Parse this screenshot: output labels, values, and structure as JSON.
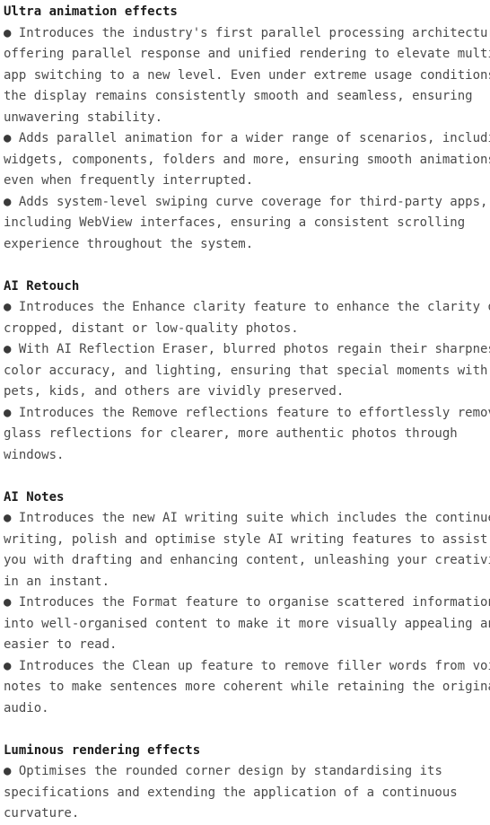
{
  "document": {
    "type": "release-notes",
    "background_color": "#ffffff",
    "heading_color": "#1b1b1b",
    "body_color": "#4a4a4a",
    "bullet_glyph": "●",
    "sections": [
      {
        "heading": "Ultra animation effects",
        "bullets": [
          {
            "lines": [
              "Introduces the industry's first parallel processing architecture,",
              "offering parallel response and unified rendering to elevate multi-",
              "app switching to a new level. Even under extreme usage conditions,",
              "the display remains consistently smooth and seamless, ensuring",
              "unwavering stability."
            ],
            "text": "Introduces the industry's first parallel processing architecture, offering parallel response and unified rendering to elevate multi-app switching to a new level. Even under extreme usage conditions, the display remains consistently smooth and seamless, ensuring unwavering stability."
          },
          {
            "lines": [
              "Adds parallel animation for a wider range of scenarios, including",
              "widgets, components, folders and more, ensuring smooth animations",
              "even when frequently interrupted."
            ],
            "text": "Adds parallel animation for a wider range of scenarios, including widgets, components, folders and more, ensuring smooth animations even when frequently interrupted."
          },
          {
            "lines": [
              "Adds system-level swiping curve coverage for third-party apps,",
              "including WebView interfaces, ensuring a consistent scrolling",
              "experience throughout the system."
            ],
            "text": "Adds system-level swiping curve coverage for third-party apps, including WebView interfaces, ensuring a consistent scrolling experience throughout the system."
          }
        ]
      },
      {
        "heading": "AI Retouch",
        "bullets": [
          {
            "lines": [
              "Introduces the Enhance clarity feature to enhance the clarity of",
              "cropped, distant or low-quality photos."
            ],
            "text": "Introduces the Enhance clarity feature to enhance the clarity of cropped, distant or low-quality photos."
          },
          {
            "lines": [
              "With AI Reflection Eraser, blurred photos regain their sharpness,",
              "color accuracy, and lighting, ensuring that special moments with",
              "pets, kids, and others are vividly preserved."
            ],
            "text": "With AI Reflection Eraser, blurred photos regain their sharpness, color accuracy, and lighting, ensuring that special moments with pets, kids, and others are vividly preserved."
          },
          {
            "lines": [
              "Introduces the Remove reflections feature to effortlessly remove",
              "glass reflections for clearer, more authentic photos through",
              "windows."
            ],
            "text": "Introduces the Remove reflections feature to effortlessly remove glass reflections for clearer, more authentic photos through windows."
          }
        ]
      },
      {
        "heading": "AI Notes",
        "bullets": [
          {
            "lines": [
              "Introduces the new AI writing suite which includes the continue",
              "writing, polish and optimise style AI writing features to assist",
              "you with drafting and enhancing content, unleashing your creativity",
              "in an instant."
            ],
            "text": "Introduces the new AI writing suite which includes the continue writing, polish and optimise style AI writing features to assist you with drafting and enhancing content, unleashing your creativity in an instant."
          },
          {
            "lines": [
              "Introduces the Format feature to organise scattered information",
              "into well-organised content to make it more visually appealing and",
              "easier to read."
            ],
            "text": "Introduces the Format feature to organise scattered information into well-organised content to make it more visually appealing and easier to read."
          },
          {
            "lines": [
              "Introduces the Clean up feature to remove filler words from voice",
              "notes to make sentences more coherent while retaining the original",
              "audio."
            ],
            "text": "Introduces the Clean up feature to remove filler words from voice notes to make sentences more coherent while retaining the original audio."
          }
        ]
      },
      {
        "heading": "Luminous rendering effects",
        "bullets": [
          {
            "lines": [
              "Optimises the rounded corner design by standardising its",
              "specifications and extending the application of a continuous",
              "curvature."
            ],
            "text": "Optimises the rounded corner design by standardising its specifications and extending the application of a continuous curvature."
          }
        ]
      }
    ]
  }
}
